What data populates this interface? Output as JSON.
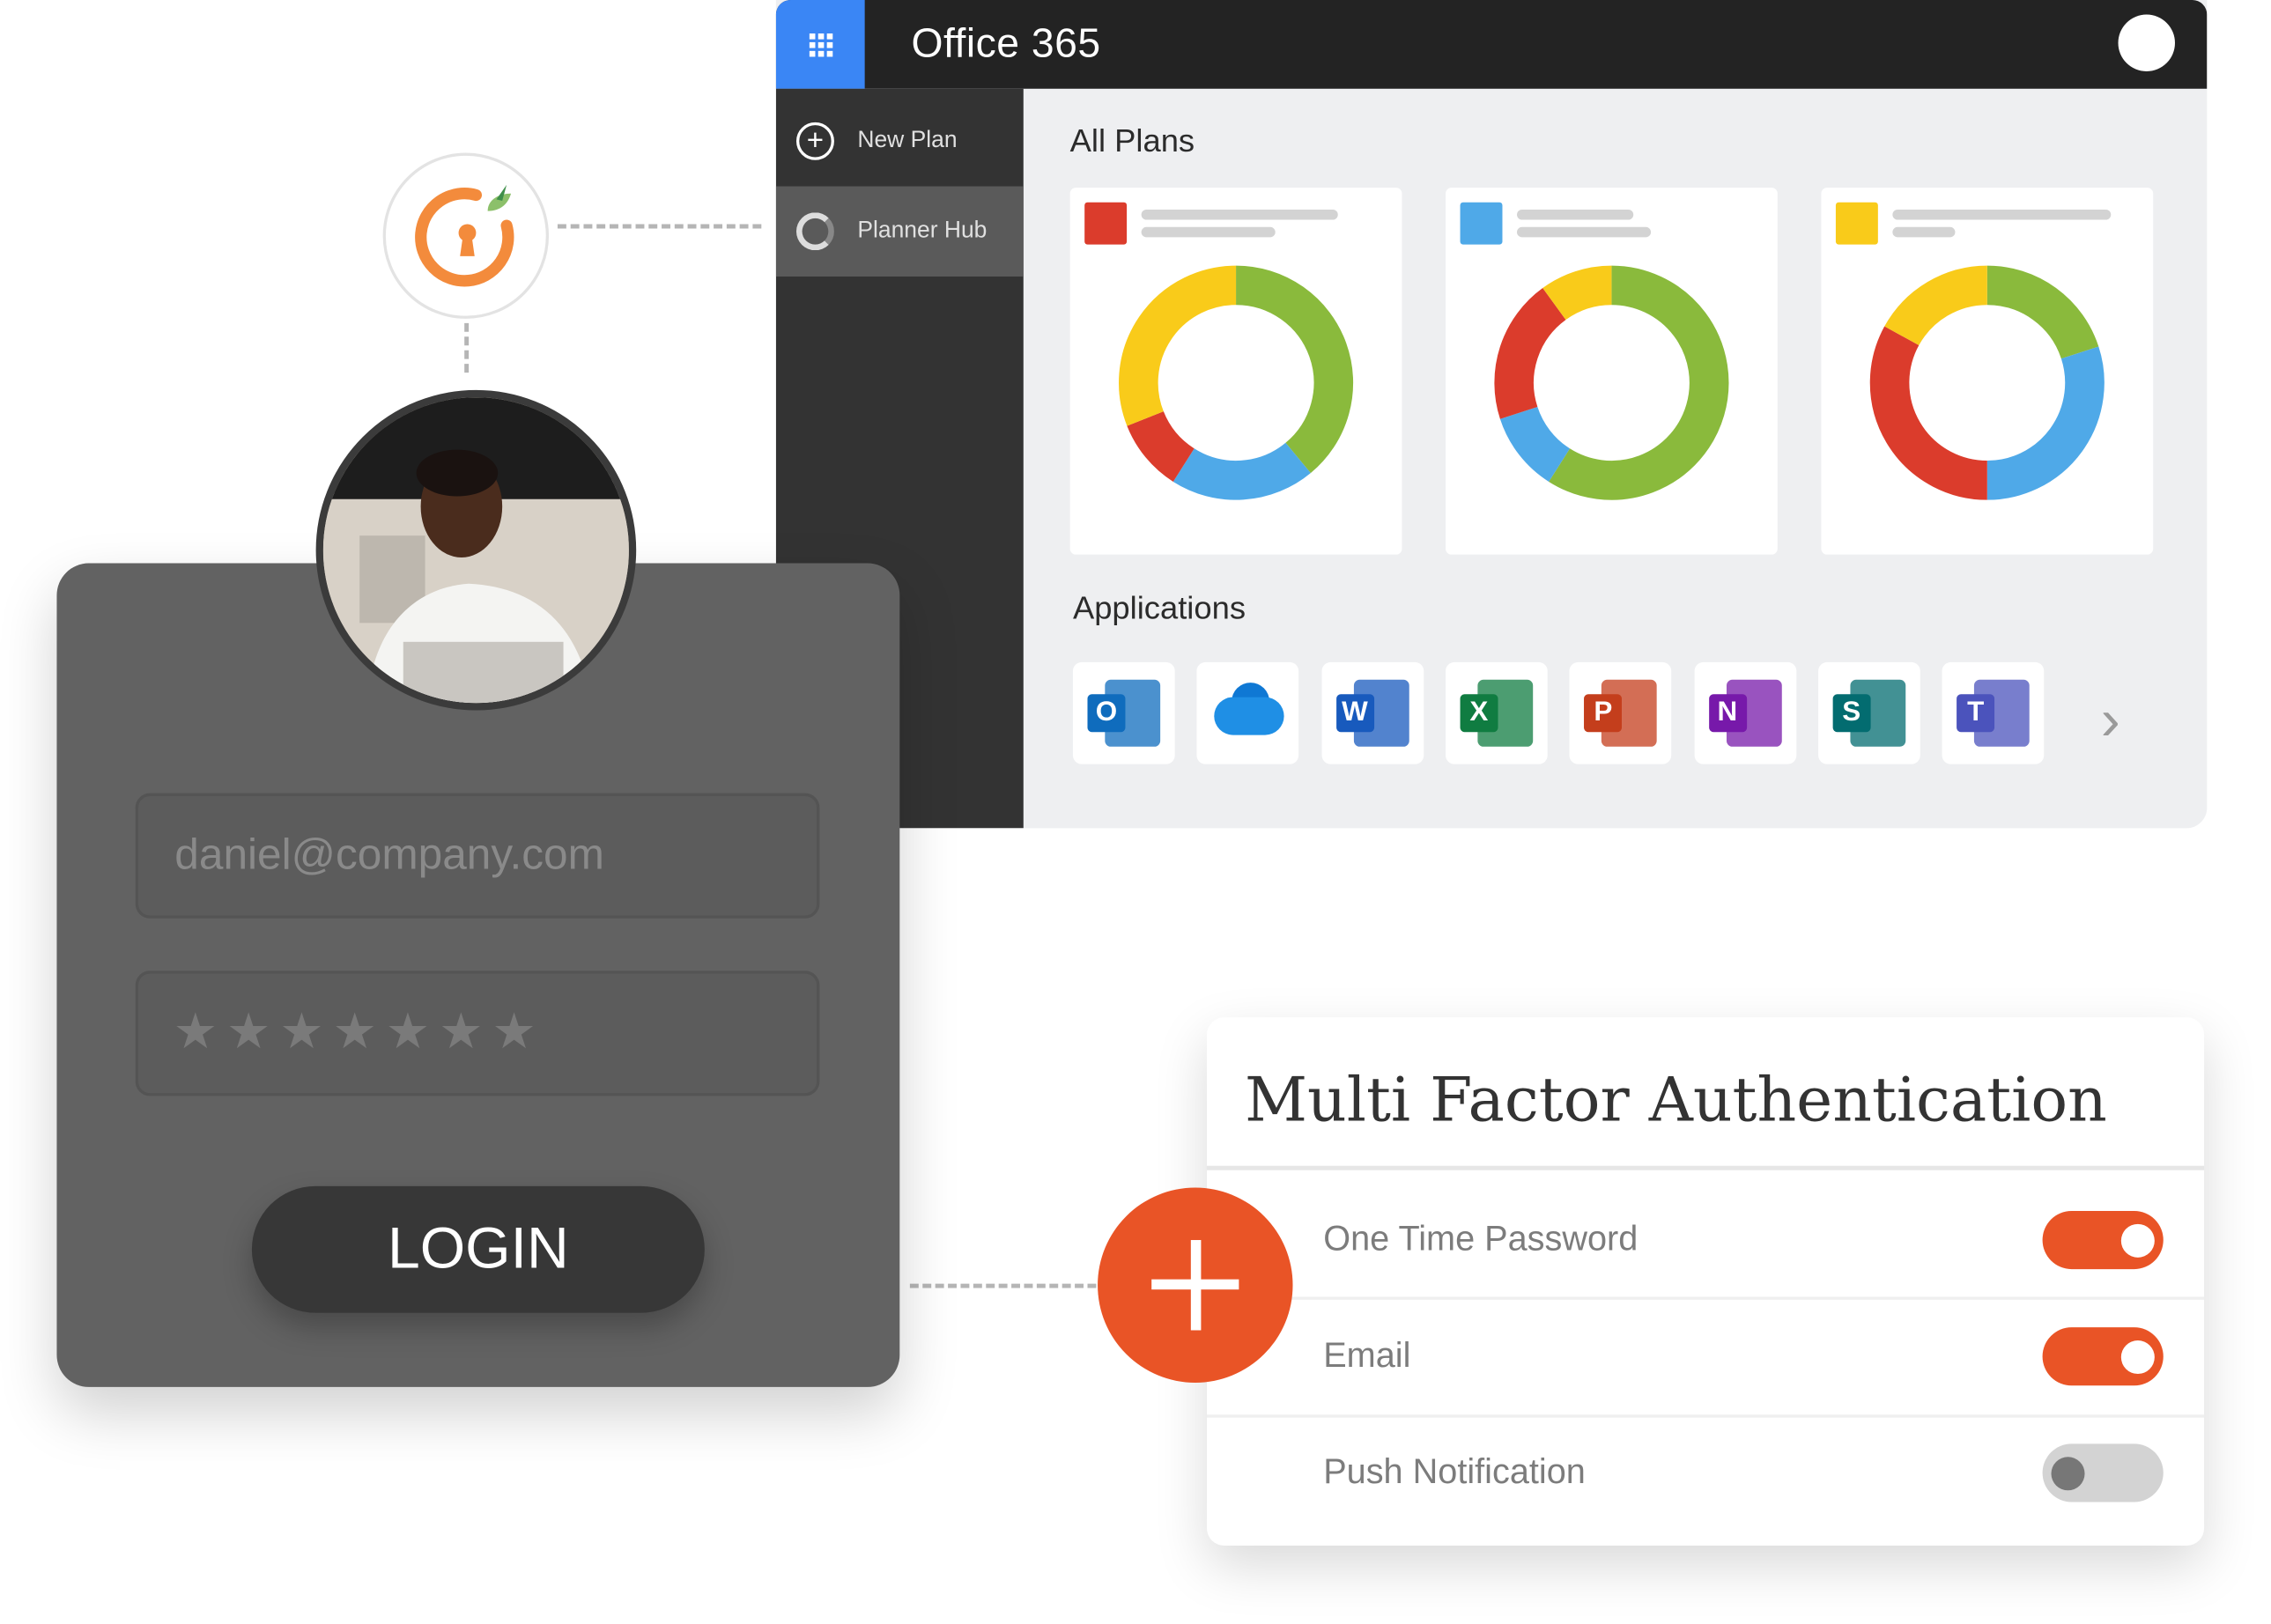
{
  "office": {
    "title": "Office 365",
    "apps_icon": "waffle-grid-icon",
    "profile_icon": "profile-avatar-icon",
    "sidebar": {
      "items": [
        {
          "label": "New Plan",
          "icon": "plus-circle-icon",
          "active": false
        },
        {
          "label": "Planner Hub",
          "icon": "progress-ring-icon",
          "active": true
        }
      ]
    },
    "all_plans_heading": "All Plans",
    "applications_heading": "Applications",
    "applications": [
      {
        "name": "Outlook",
        "letter": "O",
        "color": "#0f6cbd"
      },
      {
        "name": "OneDrive",
        "letter": "",
        "color": "#0f78d4"
      },
      {
        "name": "Word",
        "letter": "W",
        "color": "#185abd"
      },
      {
        "name": "Excel",
        "letter": "X",
        "color": "#107c41"
      },
      {
        "name": "PowerPoint",
        "letter": "P",
        "color": "#c43e1c"
      },
      {
        "name": "OneNote",
        "letter": "N",
        "color": "#7719aa"
      },
      {
        "name": "SharePoint",
        "letter": "S",
        "color": "#036c70"
      },
      {
        "name": "Teams",
        "letter": "T",
        "color": "#4b53bc"
      }
    ],
    "next_icon": "chevron-right-icon"
  },
  "colors": {
    "green": "#8aba3c",
    "yellow": "#f9cb1a",
    "red": "#db3c2c",
    "blue": "#4fa9e8",
    "accent_orange": "#e95426",
    "office_blue": "#3a86f5"
  },
  "chart_data": [
    {
      "type": "pie",
      "title": "",
      "swatch_color": "#db3c2c",
      "categories": [
        "green",
        "blue",
        "red",
        "yellow"
      ],
      "values": [
        39,
        20,
        10,
        31
      ]
    },
    {
      "type": "pie",
      "title": "",
      "swatch_color": "#4fa9e8",
      "categories": [
        "green",
        "blue",
        "red",
        "yellow"
      ],
      "values": [
        59,
        11,
        20,
        10
      ]
    },
    {
      "type": "pie",
      "title": "",
      "swatch_color": "#f9cb1a",
      "categories": [
        "green",
        "blue",
        "red",
        "yellow"
      ],
      "values": [
        20,
        30,
        33,
        17
      ]
    }
  ],
  "logo": {
    "icon": "keyhole-logo-icon"
  },
  "login": {
    "email_value": "daniel@company.com",
    "password_masked": "★★★★★★★",
    "button_label": "LOGIN",
    "avatar": "user-photo"
  },
  "mfa": {
    "title": "Multi Factor Authentication",
    "add_icon": "plus-icon",
    "options": [
      {
        "label": "One Time Password",
        "enabled": true
      },
      {
        "label": "Email",
        "enabled": true
      },
      {
        "label": "Push Notification",
        "enabled": false
      }
    ]
  }
}
